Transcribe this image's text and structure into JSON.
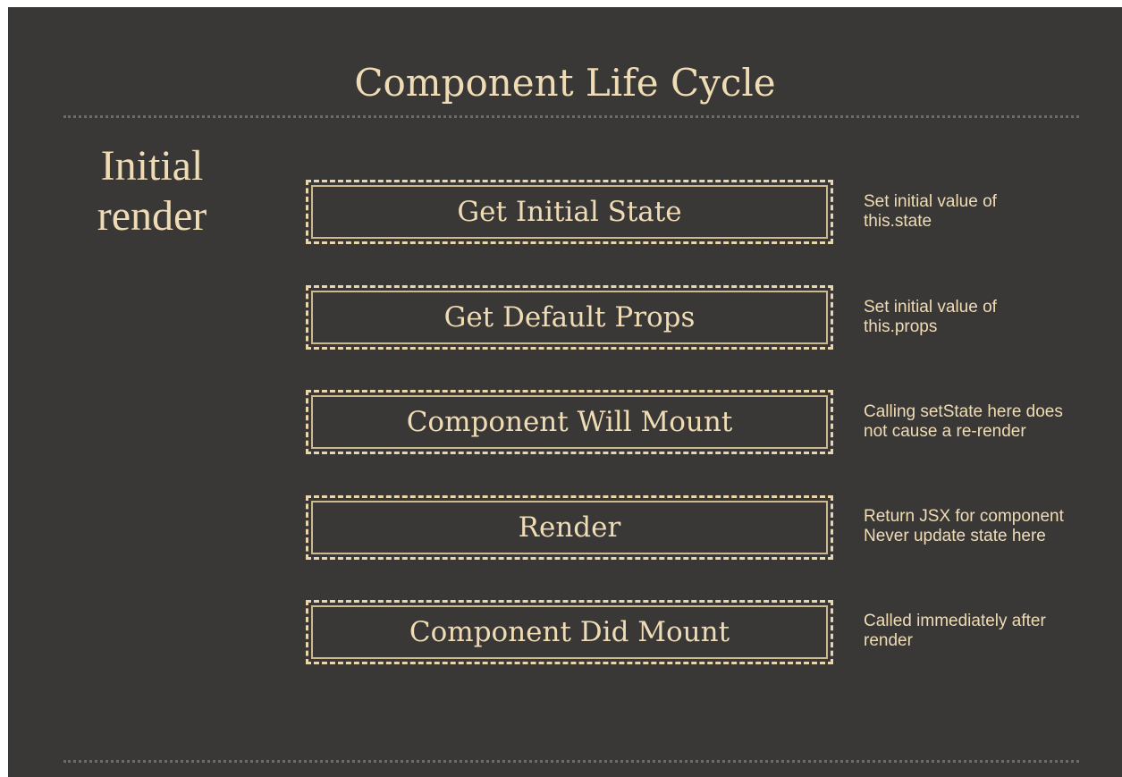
{
  "title": "Component Life Cycle",
  "section_label": "Initial\nrender",
  "steps": [
    {
      "label": "Get Initial State",
      "note": "Set initial value of\nthis.state"
    },
    {
      "label": "Get Default Props",
      "note": "Set initial value of\nthis.props"
    },
    {
      "label": "Component Will Mount",
      "note": "Calling setState here does\nnot cause a re-render"
    },
    {
      "label": "Render",
      "note": "Return JSX for component\nNever update state here"
    },
    {
      "label": "Component Did Mount",
      "note": "Called immediately after\nrender"
    }
  ],
  "colors": {
    "background": "#393837",
    "text": "#efdcb4",
    "box_border": "#e9d6ac",
    "divider": "#6d6b67"
  }
}
